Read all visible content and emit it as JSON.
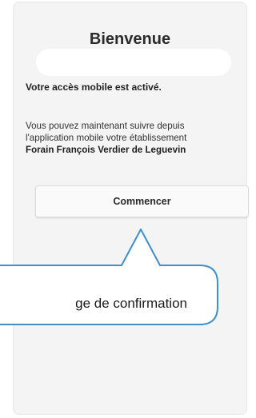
{
  "welcome": {
    "title": "Bienvenue"
  },
  "status": {
    "activated": "Votre accès mobile est activé."
  },
  "info": {
    "line1": "Vous pouvez maintenant suivre depuis",
    "line2": "l'application mobile votre établissement",
    "establishment": "Forain François Verdier de Leguevin"
  },
  "actions": {
    "start_label": "Commencer"
  },
  "callout": {
    "text": "ge de confirmation",
    "border_color": "#3c8fd0"
  },
  "colors": {
    "screen_background": "#f4f4f4",
    "button_background": "#fafafa"
  }
}
